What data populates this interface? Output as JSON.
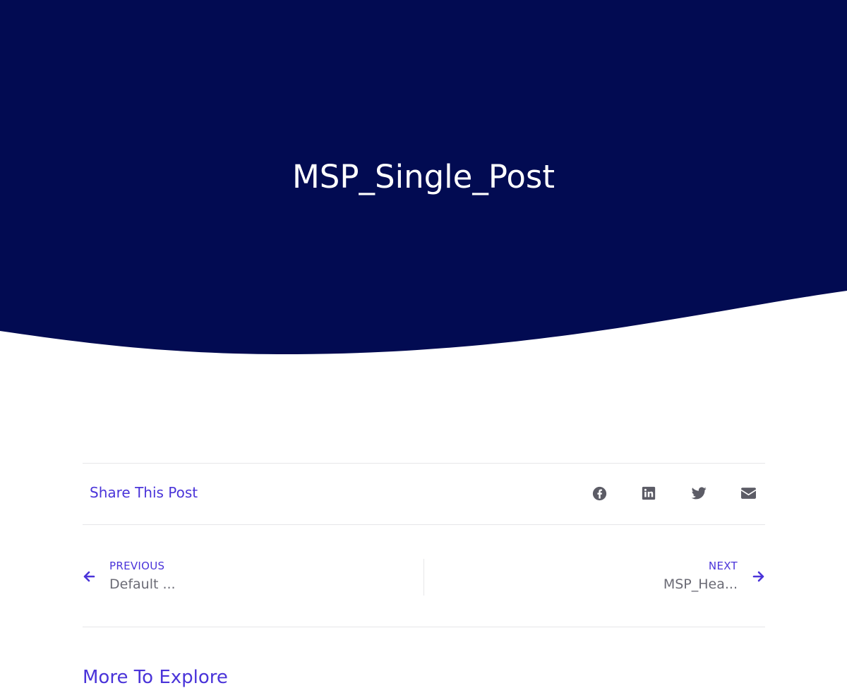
{
  "hero": {
    "title": "MSP_Single_Post",
    "background_color": "#020b52"
  },
  "share": {
    "label": "Share This Post",
    "icons": [
      "facebook-icon",
      "linkedin-icon",
      "twitter-icon",
      "envelope-icon"
    ]
  },
  "post_nav": {
    "previous": {
      "kicker": "PREVIOUS",
      "title": "Default ..."
    },
    "next": {
      "kicker": "NEXT",
      "title": "MSP_Hea..."
    }
  },
  "more": {
    "heading": "More To Explore"
  },
  "colors": {
    "accent": "#4a34d9",
    "muted_text": "#6b6b75",
    "icon": "#5c5c66",
    "divider": "#e6e6e9"
  }
}
